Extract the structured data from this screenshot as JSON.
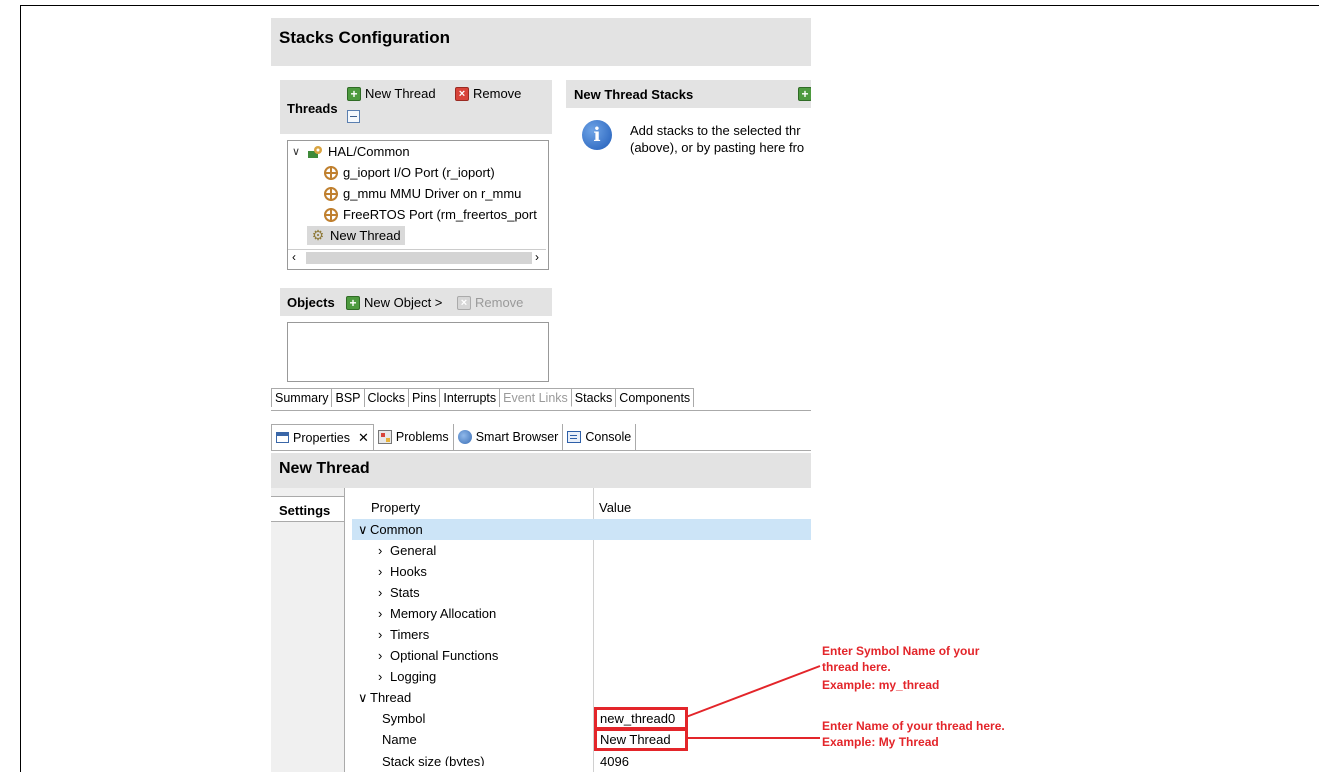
{
  "header": {
    "title": "Stacks Configuration"
  },
  "threads": {
    "label": "Threads",
    "new_thread_btn": "New Thread",
    "remove_btn": "Remove",
    "tree": [
      {
        "label": "HAL/Common"
      },
      {
        "label": "g_ioport I/O Port (r_ioport)"
      },
      {
        "label": "g_mmu MMU Driver on r_mmu"
      },
      {
        "label": "FreeRTOS Port (rm_freertos_port"
      },
      {
        "label": "New Thread"
      }
    ]
  },
  "stacks": {
    "label": "New Thread Stacks",
    "info_line1": "Add stacks to the selected thr",
    "info_line2": "(above), or by pasting here fro"
  },
  "objects": {
    "label": "Objects",
    "new_object_btn": "New Object >",
    "remove_btn": "Remove"
  },
  "config_tabs": [
    "Summary",
    "BSP",
    "Clocks",
    "Pins",
    "Interrupts",
    "Event Links",
    "Stacks",
    "Components"
  ],
  "view_tabs": {
    "properties": "Properties",
    "problems": "Problems",
    "smart_browser": "Smart Browser",
    "console": "Console"
  },
  "props": {
    "title": "New Thread",
    "settings_tab": "Settings",
    "col_property": "Property",
    "col_value": "Value",
    "rows": [
      {
        "label": "Common",
        "value": ""
      },
      {
        "label": "General",
        "value": ""
      },
      {
        "label": "Hooks",
        "value": ""
      },
      {
        "label": "Stats",
        "value": ""
      },
      {
        "label": "Memory Allocation",
        "value": ""
      },
      {
        "label": "Timers",
        "value": ""
      },
      {
        "label": "Optional Functions",
        "value": ""
      },
      {
        "label": "Logging",
        "value": ""
      },
      {
        "label": "Thread",
        "value": ""
      },
      {
        "label": "Symbol",
        "value": "new_thread0"
      },
      {
        "label": "Name",
        "value": "New Thread"
      },
      {
        "label": "Stack size (bytes)",
        "value": "4096"
      }
    ]
  },
  "annotations": {
    "symbol_note_l1": "Enter Symbol Name of your",
    "symbol_note_l2": "thread here.",
    "symbol_note_l3": "Example: my_thread",
    "name_note_l1": "Enter Name of your thread here.",
    "name_note_l2": "Example: My Thread",
    "color": "#e3252a"
  }
}
